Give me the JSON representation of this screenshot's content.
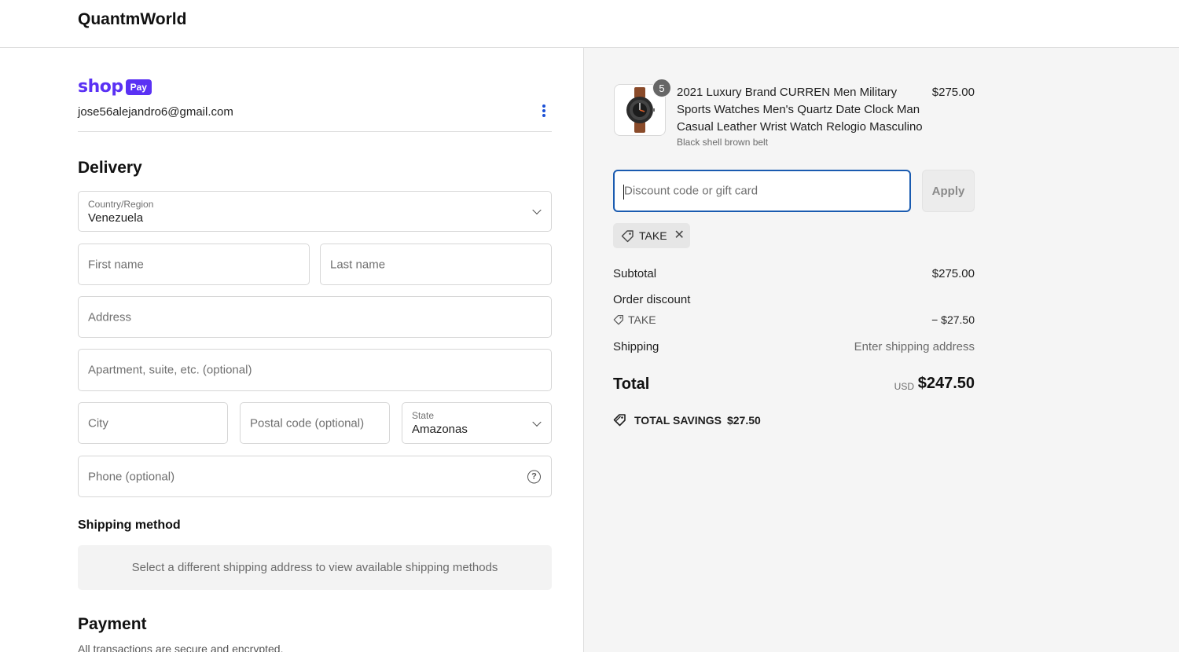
{
  "header": {
    "brand": "QuantmWorld"
  },
  "account": {
    "shop_word": "shop",
    "pay_badge": "Pay",
    "email": "jose56alejandro6@gmail.com"
  },
  "delivery": {
    "title": "Delivery",
    "country": {
      "label": "Country/Region",
      "value": "Venezuela"
    },
    "first_name_placeholder": "First name",
    "last_name_placeholder": "Last name",
    "address_placeholder": "Address",
    "apartment_placeholder": "Apartment, suite, etc. (optional)",
    "city_placeholder": "City",
    "postal_placeholder": "Postal code (optional)",
    "state": {
      "label": "State",
      "value": "Amazonas"
    },
    "phone_placeholder": "Phone (optional)"
  },
  "shipping_method": {
    "title": "Shipping method",
    "message": "Select a different shipping address to view available shipping methods"
  },
  "payment": {
    "title": "Payment",
    "subtitle": "All transactions are secure and encrypted."
  },
  "summary": {
    "product": {
      "quantity": "5",
      "name": "2021 Luxury Brand CURREN Men Military Sports Watches Men's Quartz Date Clock Man Casual Leather Wrist Watch Relogio Masculino",
      "variant": "Black shell brown belt",
      "price": "$275.00"
    },
    "discount_placeholder": "Discount code or gift card",
    "apply_label": "Apply",
    "applied_code": "TAKE",
    "subtotal_label": "Subtotal",
    "subtotal_value": "$275.00",
    "order_discount_label": "Order discount",
    "order_discount_code": "TAKE",
    "order_discount_value": "− $27.50",
    "shipping_label": "Shipping",
    "shipping_value": "Enter shipping address",
    "total_label": "Total",
    "currency": "USD",
    "total_value": "$247.50",
    "savings_label": "TOTAL SAVINGS",
    "savings_value": "$27.50"
  },
  "colors": {
    "shop_pay": "#5a31f4",
    "focus_border": "#1a5bb0",
    "summary_bg": "#f5f5f5"
  }
}
